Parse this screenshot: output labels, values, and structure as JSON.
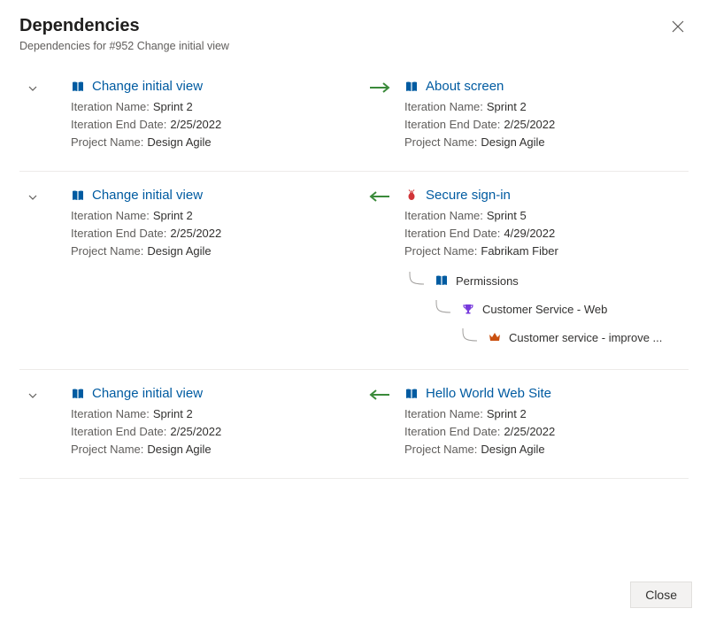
{
  "dialog": {
    "title": "Dependencies",
    "subtitle": "Dependencies for #952 Change initial view",
    "close_label": "Close"
  },
  "labels": {
    "iteration_name": "Iteration Name:",
    "iteration_end": "Iteration End Date:",
    "project_name": "Project Name:"
  },
  "colors": {
    "link": "#005ba1",
    "green": "#3a8a3a",
    "book": "#005ba1",
    "bug": "#d13438",
    "trophy": "#773adc",
    "crown": "#ca5010"
  },
  "dependencies": [
    {
      "direction": "right",
      "left": {
        "icon": "book",
        "title": "Change initial view",
        "iteration_name": "Sprint 2",
        "iteration_end": "2/25/2022",
        "project_name": "Design Agile"
      },
      "right": {
        "icon": "book",
        "title": "About screen",
        "iteration_name": "Sprint 2",
        "iteration_end": "2/25/2022",
        "project_name": "Design Agile"
      }
    },
    {
      "direction": "left",
      "left": {
        "icon": "book",
        "title": "Change initial view",
        "iteration_name": "Sprint 2",
        "iteration_end": "2/25/2022",
        "project_name": "Design Agile"
      },
      "right": {
        "icon": "bug",
        "title": "Secure sign-in",
        "iteration_name": "Sprint 5",
        "iteration_end": "4/29/2022",
        "project_name": "Fabrikam Fiber",
        "children": [
          {
            "icon": "book",
            "indent": 0,
            "label": "Permissions"
          },
          {
            "icon": "trophy",
            "indent": 1,
            "label": "Customer Service - Web"
          },
          {
            "icon": "crown",
            "indent": 2,
            "label": "Customer service - improve ..."
          }
        ]
      }
    },
    {
      "direction": "left",
      "left": {
        "icon": "book",
        "title": "Change initial view",
        "iteration_name": "Sprint 2",
        "iteration_end": "2/25/2022",
        "project_name": "Design Agile"
      },
      "right": {
        "icon": "book",
        "title": "Hello World Web Site",
        "iteration_name": "Sprint 2",
        "iteration_end": "2/25/2022",
        "project_name": "Design Agile"
      }
    }
  ]
}
